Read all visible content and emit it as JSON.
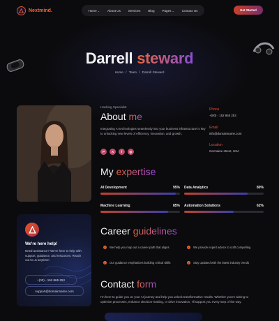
{
  "header": {
    "logo_text": "Nextmind.",
    "nav": [
      {
        "label": "Home",
        "has_dropdown": true
      },
      {
        "label": "About Us",
        "has_dropdown": false
      },
      {
        "label": "Services",
        "has_dropdown": false
      },
      {
        "label": "Blog",
        "has_dropdown": false
      },
      {
        "label": "Pages",
        "has_dropdown": true
      },
      {
        "label": "Contact Us",
        "has_dropdown": false
      }
    ],
    "cta_label": "Get Started"
  },
  "hero": {
    "first_name": "Darrell",
    "last_name": "steward",
    "breadcrumb": [
      "Home",
      "/",
      "Team",
      "/",
      "Darrell Steward"
    ]
  },
  "about": {
    "role": "Hacking Specialist",
    "title_part1": "About",
    "title_part2": "me",
    "text": "Integrating AI technologies seamlessly into your business infrastructure is key to unlocking new levels of efficiency, innovation, and growth.",
    "socials": [
      "P",
      "X",
      "f",
      "◎"
    ]
  },
  "contact_info": [
    {
      "label": "Phone",
      "value": "+(00) - 152 865 253"
    },
    {
      "label": "Email",
      "value": "info@domainname.com"
    },
    {
      "label": "Location",
      "value": "Germaine street, USA"
    }
  ],
  "expertise": {
    "title_part1": "My",
    "title_part2": "expertise",
    "skills": [
      {
        "name": "AI Development",
        "percent_label": "95%",
        "percent": 95
      },
      {
        "name": "Data Analytics",
        "percent_label": "80%",
        "percent": 80
      },
      {
        "name": "Machine Learning",
        "percent_label": "85%",
        "percent": 85
      },
      {
        "name": "Automation Solutions",
        "percent_label": "62%",
        "percent": 62
      }
    ]
  },
  "career": {
    "title_part1": "Career",
    "title_part2": "guidelines",
    "items": [
      "We help you map out a career path that aligns",
      "We provide expert advice to craft compelling",
      "Our guidance emphasizes building critical skills",
      "Stay updated with the latest industry trends"
    ]
  },
  "contact_form": {
    "title_part1": "Contact",
    "title_part2": "form",
    "text": "I'm here to guide you on your AI journey and help you unlock transformative results. Whether you're aiming to optimize processes, enhance decision-making, or drive innovation, I'll support you every step of the way."
  },
  "help_card": {
    "title": "We're here help!",
    "text": "Need assistance? We're here to help with support, guidance, and resources. Reach out to us anytime!",
    "phone": "+(00) - 152 865 253",
    "email": "support@domainname.com"
  },
  "colors": {
    "accent_orange": "#e6673b",
    "accent_purple": "#8a4fd8",
    "background": "#0b0b0e"
  }
}
